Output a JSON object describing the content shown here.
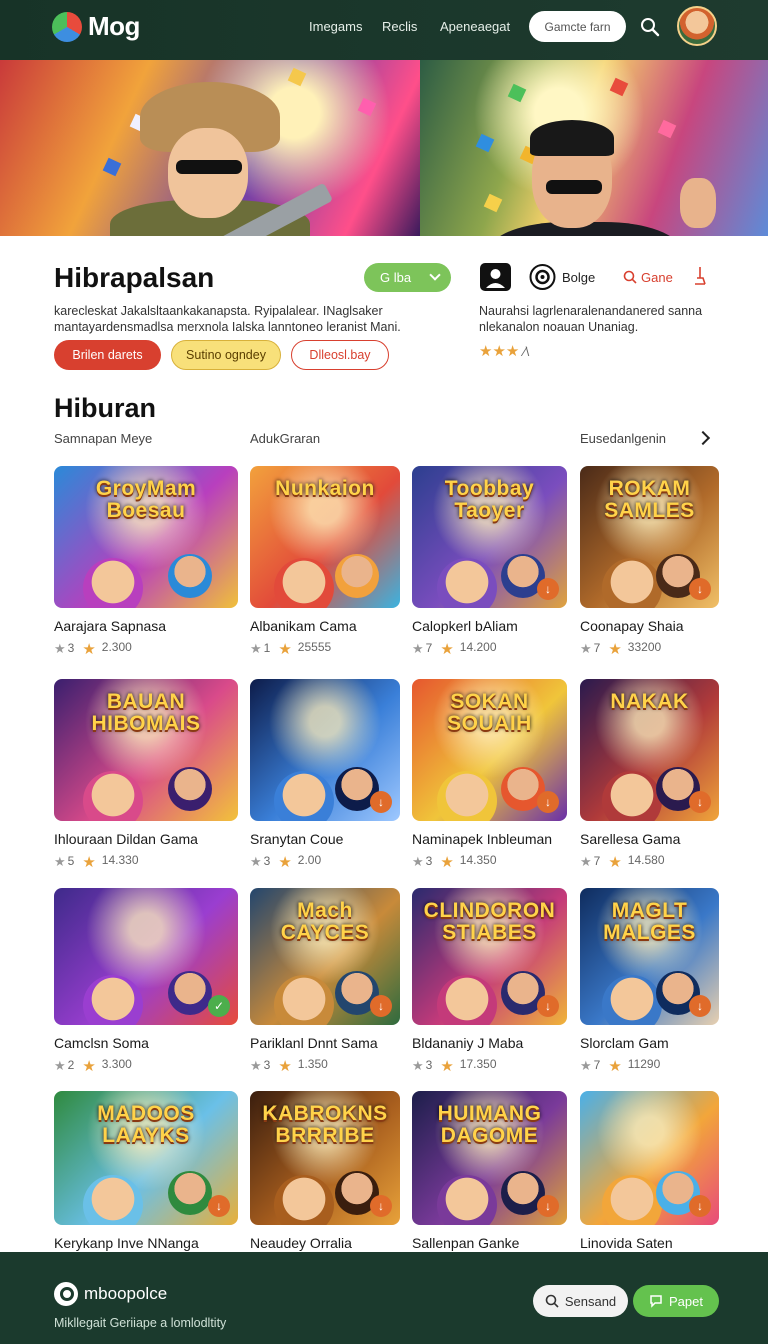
{
  "header": {
    "logo_text": "Mog",
    "nav": [
      "Imegams",
      "Reclis",
      "Apeneaegat"
    ],
    "search_label": "Gamcte farn"
  },
  "intro": {
    "title": "Hibrapalsan",
    "dropdown_label": "G lba",
    "description": "karecleskat Jakalsltaankakanapsta. Ryipalalear. INaglsaker mantayardensmadlsa merxnola Ialska lanntoneo leranist Mani.",
    "buttons": [
      "Brilen darets",
      "Sutino ogndey",
      "Dlleosl.bay"
    ]
  },
  "side_panel": {
    "label_1": "Bolge",
    "label_2": "Gane",
    "description": "Naurahsi lagrlenaralenandanered sanna nlekanalon noauan Unaniag.",
    "rating_stars": "★★★",
    "rating_extra": "⁄\\"
  },
  "section": {
    "title": "Hiburan",
    "filters": [
      "Samnapan Meye",
      "AdukGraran",
      "Eusedanlgenin"
    ]
  },
  "cards": [
    {
      "title": "Aarajara Sapnasa",
      "rank": "3",
      "score": "2.300",
      "art": "GroyMam Boesau"
    },
    {
      "title": "Albanikam Cama",
      "rank": "1",
      "score": "25555",
      "art": "Nunkaion"
    },
    {
      "title": "Calopkerl bAliam",
      "rank": "7",
      "score": "14.200",
      "art": "Toobbay Taoyer"
    },
    {
      "title": "Coonapay Shaia",
      "rank": "7",
      "score": "33200",
      "art": "ROKAM SAMLES"
    },
    {
      "title": "Ihlouraan Dildan Gama",
      "rank": "5",
      "score": "14.330",
      "art": "BAUAN HIBOMAIS"
    },
    {
      "title": "Sranytan Coue",
      "rank": "3",
      "score": "2.00",
      "art": ""
    },
    {
      "title": "Naminapek Inbleuman",
      "rank": "3",
      "score": "14.350",
      "art": "SOKAN SOUAIH"
    },
    {
      "title": "Sarellesa Gama",
      "rank": "7",
      "score": "14.580",
      "art": "NAKAK"
    },
    {
      "title": "Camclsn Soma",
      "rank": "2",
      "score": "3.300",
      "art": ""
    },
    {
      "title": "Pariklanl Dnnt Sama",
      "rank": "3",
      "score": "1.350",
      "art": "Mach CAYCES"
    },
    {
      "title": "Bldananiy J Maba",
      "rank": "3",
      "score": "17.350",
      "art": "CLINDORON STIABES"
    },
    {
      "title": "Slorclam Gam",
      "rank": "7",
      "score": "11290",
      "art": "MAGLT MALGES"
    },
    {
      "title": "Kerykanp Inve NNanga",
      "rank": "",
      "score": "",
      "art": "MADOOS LAAYKS"
    },
    {
      "title": "Neaudey Orralia",
      "rank": "",
      "score": "",
      "art": "KABROKNS BRRRIBE"
    },
    {
      "title": "Sallenpan Ganke",
      "rank": "",
      "score": "",
      "art": "HUIMANG DAGOME"
    },
    {
      "title": "Linovida Saten",
      "rank": "",
      "score": "",
      "art": ""
    }
  ],
  "footer": {
    "logo_text": "mboopolce",
    "subtitle": "Mikllegait  Geriiape a lomlodltity",
    "btn_secondary": "Sensand",
    "btn_primary": "Papet"
  },
  "colors": {
    "accent_green": "#7dc45a",
    "accent_red": "#d8402f",
    "footer_bg": "#1b3a2d"
  }
}
